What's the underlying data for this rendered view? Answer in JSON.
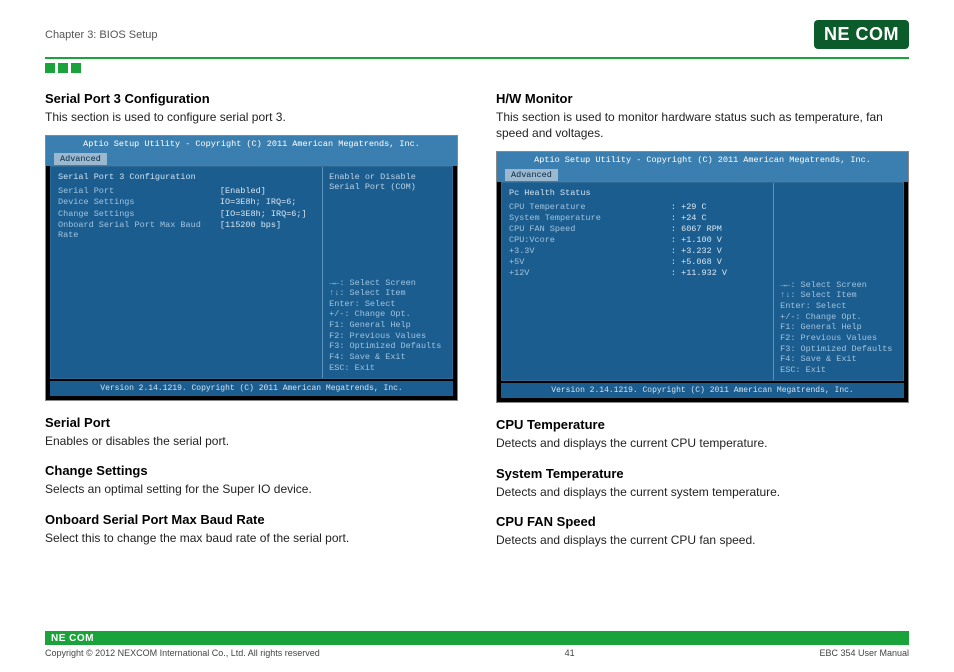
{
  "header": {
    "chapter": "Chapter 3: BIOS Setup",
    "logo_text": "NE COM"
  },
  "left": {
    "section1_title": "Serial Port 3 Configuration",
    "section1_body": "This section is used to configure serial port 3.",
    "bios": {
      "top": "Aptio Setup Utility - Copyright (C) 2011 American Megatrends, Inc.",
      "tab": "Advanced",
      "title_row": "Serial Port 3 Configuration",
      "rows": [
        {
          "k": "Serial Port",
          "v": "[Enabled]"
        },
        {
          "k": "Device Settings",
          "v": "IO=3E8h; IRQ=6;"
        },
        {
          "k": "",
          "v": ""
        },
        {
          "k": "Change Settings",
          "v": "[IO=3E8h; IRQ=6;]"
        },
        {
          "k": "Onboard Serial Port Max Baud Rate",
          "v": "[115200 bps]"
        }
      ],
      "right_top": "Enable or Disable Serial Port (COM)",
      "help": [
        "→←: Select Screen",
        "↑↓: Select Item",
        "Enter: Select",
        "+/-: Change Opt.",
        "F1: General Help",
        "F2: Previous Values",
        "F3: Optimized Defaults",
        "F4: Save & Exit",
        "ESC: Exit"
      ],
      "footer": "Version 2.14.1219. Copyright (C) 2011 American Megatrends, Inc."
    },
    "sub1_title": "Serial Port",
    "sub1_body": "Enables or disables the serial port.",
    "sub2_title": "Change Settings",
    "sub2_body": "Selects an optimal setting for the Super IO device.",
    "sub3_title": "Onboard Serial Port Max Baud Rate",
    "sub3_body": "Select this to change the max baud rate of the serial port."
  },
  "right": {
    "section1_title": "H/W Monitor",
    "section1_body": "This section is used to monitor hardware status such as temperature, fan speed and voltages.",
    "bios": {
      "top": "Aptio Setup Utility - Copyright (C) 2011 American Megatrends, Inc.",
      "tab": "Advanced",
      "title_row": "Pc Health Status",
      "rows": [
        {
          "k": "CPU Temperature",
          "v": ": +29 C"
        },
        {
          "k": "System Temperature",
          "v": ": +24 C"
        },
        {
          "k": "CPU FAN Speed",
          "v": ": 6067 RPM"
        },
        {
          "k": "CPU:Vcore",
          "v": ": +1.100 V"
        },
        {
          "k": "+3.3V",
          "v": ": +3.232 V"
        },
        {
          "k": "+5V",
          "v": ": +5.068 V"
        },
        {
          "k": "+12V",
          "v": ": +11.932 V"
        }
      ],
      "right_top": "",
      "help": [
        "→←: Select Screen",
        "↑↓: Select Item",
        "Enter: Select",
        "+/-: Change Opt.",
        "F1: General Help",
        "F2: Previous Values",
        "F3: Optimized Defaults",
        "F4: Save & Exit",
        "ESC: Exit"
      ],
      "footer": "Version 2.14.1219. Copyright (C) 2011 American Megatrends, Inc."
    },
    "sub1_title": "CPU Temperature",
    "sub1_body": "Detects and displays the current CPU temperature.",
    "sub2_title": "System Temperature",
    "sub2_body": "Detects and displays the current system temperature.",
    "sub3_title": "CPU FAN Speed",
    "sub3_body": "Detects and displays the current CPU fan speed."
  },
  "footer": {
    "logo": "NE COM",
    "copyright": "Copyright © 2012 NEXCOM International Co., Ltd. All rights reserved",
    "page": "41",
    "manual": "EBC 354 User Manual"
  }
}
